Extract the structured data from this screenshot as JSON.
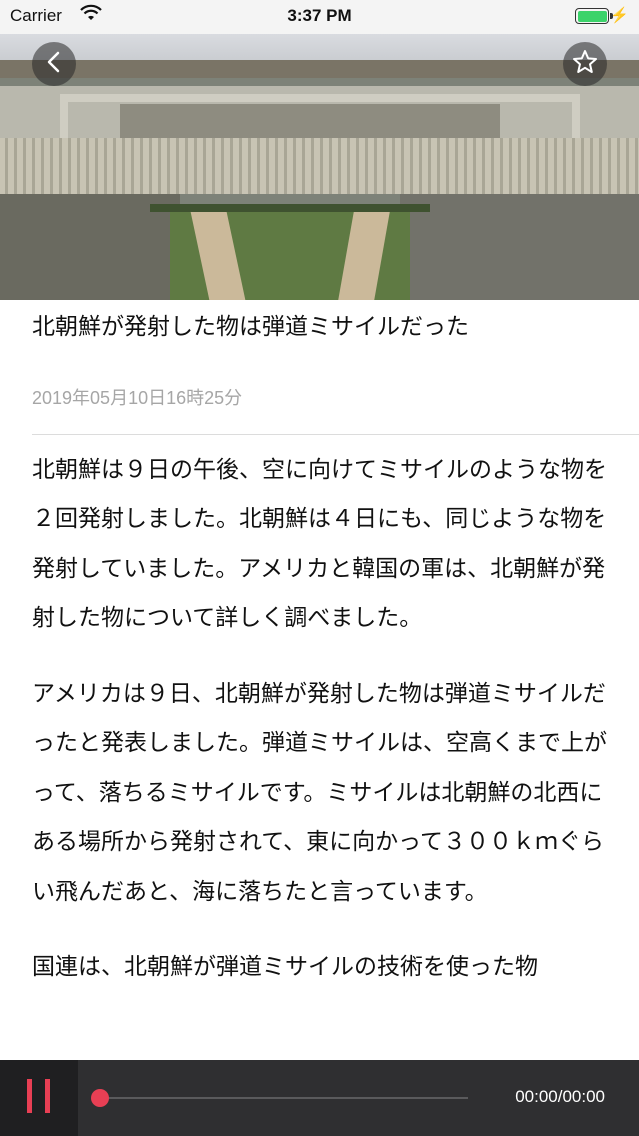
{
  "status_bar": {
    "carrier": "Carrier",
    "time": "3:37 PM",
    "wifi_icon": "wifi-icon",
    "battery_icon": "battery-charging-icon"
  },
  "hero": {
    "image_subject": "aerial view of large government building with courtyard and lawns",
    "back_icon": "chevron-left-icon",
    "favorite_icon": "star-outline-icon"
  },
  "article": {
    "title": "北朝鮮が発射した物は弾道ミサイルだった",
    "date": "2019年05月10日16時25分",
    "paragraphs": [
      "北朝鮮は９日の午後、空に向けてミサイルのような物を２回発射しました。北朝鮮は４日にも、同じような物を発射していました。アメリカと韓国の軍は、北朝鮮が発射した物について詳しく調べました。",
      "アメリカは９日、北朝鮮が発射した物は弾道ミサイルだったと発表しました。弾道ミサイルは、空高くまで上がって、落ちるミサイルです。ミサイルは北朝鮮の北西にある場所から発射されて、東に向かって３００ｋｍぐらい飛んだあと、海に落ちたと言っています。",
      "国連は、北朝鮮が弾道ミサイルの技術を使った物"
    ]
  },
  "player": {
    "pause_icon": "pause-icon",
    "time_readout": "00:00/00:00",
    "progress": 0,
    "accent_color": "#e83f54"
  }
}
